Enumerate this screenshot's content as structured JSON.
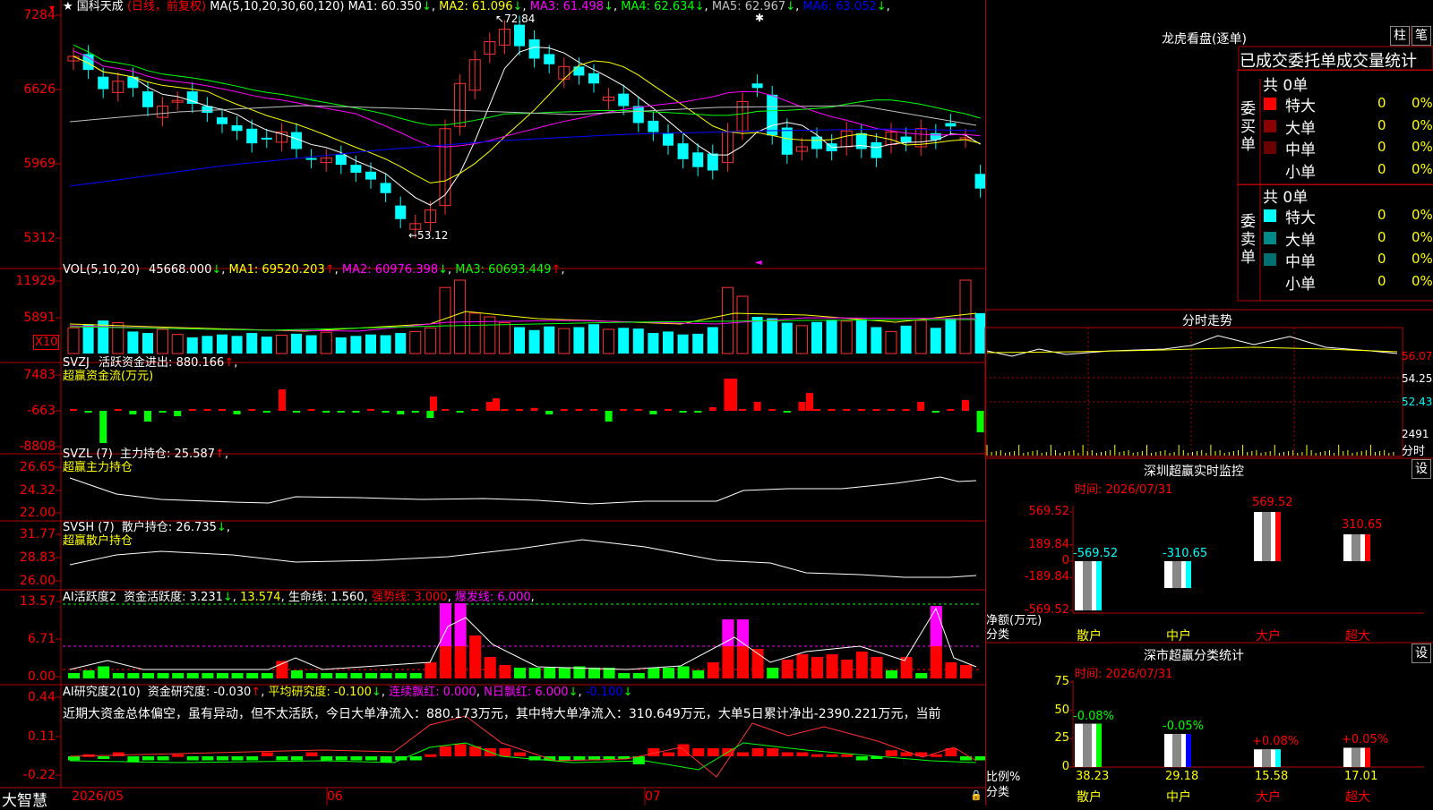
{
  "main": {
    "flag_icon": "red-flag-icon",
    "star": "★",
    "stock_name": "国科天成",
    "period": "(日线，前复权)",
    "ma_label": "MA(5,10,20,30,60,120)",
    "ma": [
      {
        "name": "MA1",
        "value": "60.350",
        "arrow": "↓",
        "color": "#ffffff"
      },
      {
        "name": "MA2",
        "value": "61.096",
        "arrow": "↓",
        "color": "#ffff00"
      },
      {
        "name": "MA3",
        "value": "61.498",
        "arrow": "↓",
        "color": "#ff00ff"
      },
      {
        "name": "MA4",
        "value": "62.634",
        "arrow": "↓",
        "color": "#00ff00"
      },
      {
        "name": "MA5",
        "value": "62.967",
        "arrow": "↓",
        "color": "#c0c0c0"
      },
      {
        "name": "MA6",
        "value": "63.052",
        "arrow": "↓",
        "color": "#0000ff"
      }
    ],
    "price_ticks": [
      "7284",
      "6626",
      "5969",
      "5312"
    ],
    "high_marker": "72.84",
    "low_marker": "←53.12",
    "price_range": [
      51.5,
      74.5
    ]
  },
  "vol": {
    "label": "VOL(5,10,20)",
    "value": "45668.000",
    "arrow": "↓",
    "ma": [
      {
        "name": "MA1",
        "value": "69520.203",
        "arrow": "↑",
        "color": "#ffff00"
      },
      {
        "name": "MA2",
        "value": "60976.398",
        "arrow": "↓",
        "color": "#ff00ff"
      },
      {
        "name": "MA3",
        "value": "60693.449",
        "arrow": "↑",
        "color": "#00ff00"
      }
    ],
    "ticks": [
      "11929",
      "5891"
    ],
    "unit": "X10"
  },
  "svzj": {
    "label": "SVZJ",
    "title": "活跃资金进出:",
    "value": "880.166",
    "arrow": "↑",
    "subtitle": "超赢资金流(万元)",
    "ticks": [
      "7483",
      "-663",
      "-8808"
    ]
  },
  "svzl": {
    "label": "SVZL (7)",
    "title": "主力持仓:",
    "value": "25.587",
    "arrow": "↑",
    "subtitle": "超赢主力持仓",
    "ticks": [
      "26.65",
      "24.32",
      "22.00"
    ]
  },
  "svsh": {
    "label": "SVSH (7)",
    "title": "散户持仓:",
    "value": "26.735",
    "arrow": "↓",
    "subtitle": "超赢散户持仓",
    "ticks": [
      "31.77",
      "28.83",
      "26.00"
    ]
  },
  "ai_active": {
    "label": "AI活跃度2",
    "title": "资金活跃度:",
    "value": "3.231",
    "arrow": "↓",
    "v2": "13.574",
    "life_label": "生命线:",
    "life_value": "1.560",
    "strong_label": "强势线:",
    "strong_value": "3.000",
    "burst_label": "爆发线:",
    "burst_value": "6.000",
    "ticks": [
      "13.57",
      "6.71",
      "0.00"
    ]
  },
  "ai_research": {
    "label": "AI研究度2(10)",
    "title": "资金研究度:",
    "value": "-0.030",
    "arrow": "↑",
    "avg_label": "平均研究度:",
    "avg_value": "-0.100",
    "red_label": "连续飘红:",
    "red_value": "0.000",
    "nday_label": "N日飘红:",
    "nday_value": "6.000",
    "tail_value": "-0.100",
    "ticks": [
      "0.44",
      "0.11",
      "-0.22"
    ],
    "comment": "近期大资金总体偏空，虽有异动，但不太活跃，今日大单净流入：880.173万元，其中特大单净流入：310.649万元，大单5日累计净出-2390.221万元，当前"
  },
  "bottom": {
    "logo": "大智慧",
    "dates": [
      "2026/05",
      "06",
      "07"
    ]
  },
  "right": {
    "dragon_title": "龙虎看盘(逐单)",
    "btn_zhu": "柱",
    "btn_bi": "笔",
    "tabs_line": "已成交委托单成交量统计",
    "buy_label": "委买单",
    "sell_label": "委卖单",
    "buy_total": "共 0单",
    "sell_total": "共 0单",
    "buy_rows": [
      {
        "label": "特大",
        "count": "0",
        "pct": "0%",
        "color": "#ff0000"
      },
      {
        "label": "大单",
        "count": "0",
        "pct": "0%",
        "color": "#8b0000"
      },
      {
        "label": "中单",
        "count": "0",
        "pct": "0%",
        "color": "#6b0000"
      },
      {
        "label": "小单",
        "count": "0",
        "pct": "0%",
        "color": ""
      }
    ],
    "sell_rows": [
      {
        "label": "特大",
        "count": "0",
        "pct": "0%",
        "color": "#00ffff"
      },
      {
        "label": "大单",
        "count": "0",
        "pct": "0%",
        "color": "#008b8b"
      },
      {
        "label": "中单",
        "count": "0",
        "pct": "0%",
        "color": "#007070"
      },
      {
        "label": "小单",
        "count": "0",
        "pct": "0%",
        "color": ""
      }
    ],
    "fenshi_title": "分时走势",
    "fenshi_ticks": [
      "56.07",
      "54.25",
      "52.43"
    ],
    "fenshi_vol": "2491",
    "fenshi_label": "分时",
    "monitor_title": "深圳超赢实时监控",
    "monitor_btn": "设",
    "monitor_time": "时间: 2026/07/31",
    "monitor_ticks": [
      "569.52",
      "189.84",
      "0",
      "-189.84",
      "-569.52"
    ],
    "monitor_ylabel": "净额(万元)",
    "monitor_xlabel": "分类",
    "stats_title": "深市超赢分类统计",
    "stats_btn": "设",
    "stats_time": "时间: 2026/07/31",
    "stats_ticks": [
      "75",
      "50",
      "25",
      "0"
    ],
    "stats_ylabel": "比例%",
    "stats_xlabel": "分类"
  },
  "chart_data": [
    {
      "type": "bar",
      "title": "深圳超赢实时监控",
      "categories": [
        "散户",
        "中户",
        "大户",
        "超大"
      ],
      "series": [
        {
          "values": [
            -569.52,
            -310.65,
            569.52,
            310.65
          ]
        }
      ],
      "value_labels": [
        "-569.52",
        "-310.65",
        "569.52",
        "310.65"
      ],
      "ylabel": "净额(万元)",
      "ylim": [
        -569.52,
        569.52
      ],
      "colors": [
        "#00ffff",
        "#00ffff",
        "#ff0000",
        "#ff0000"
      ]
    },
    {
      "type": "bar",
      "title": "深市超赢分类统计",
      "categories": [
        "散户",
        "中户",
        "大户",
        "超大"
      ],
      "values": [
        38.23,
        29.18,
        15.58,
        17.01
      ],
      "value_labels": [
        "38.23",
        "29.18",
        "15.58",
        "17.01"
      ],
      "top_labels": [
        "-0.08%",
        "-0.05%",
        "+0.08%",
        "+0.05%"
      ],
      "ylabel": "比例%",
      "ylim": [
        0,
        75
      ],
      "colors": [
        "#00ff00",
        "#0000ff",
        "#00ffff",
        "#ff0000"
      ]
    }
  ]
}
